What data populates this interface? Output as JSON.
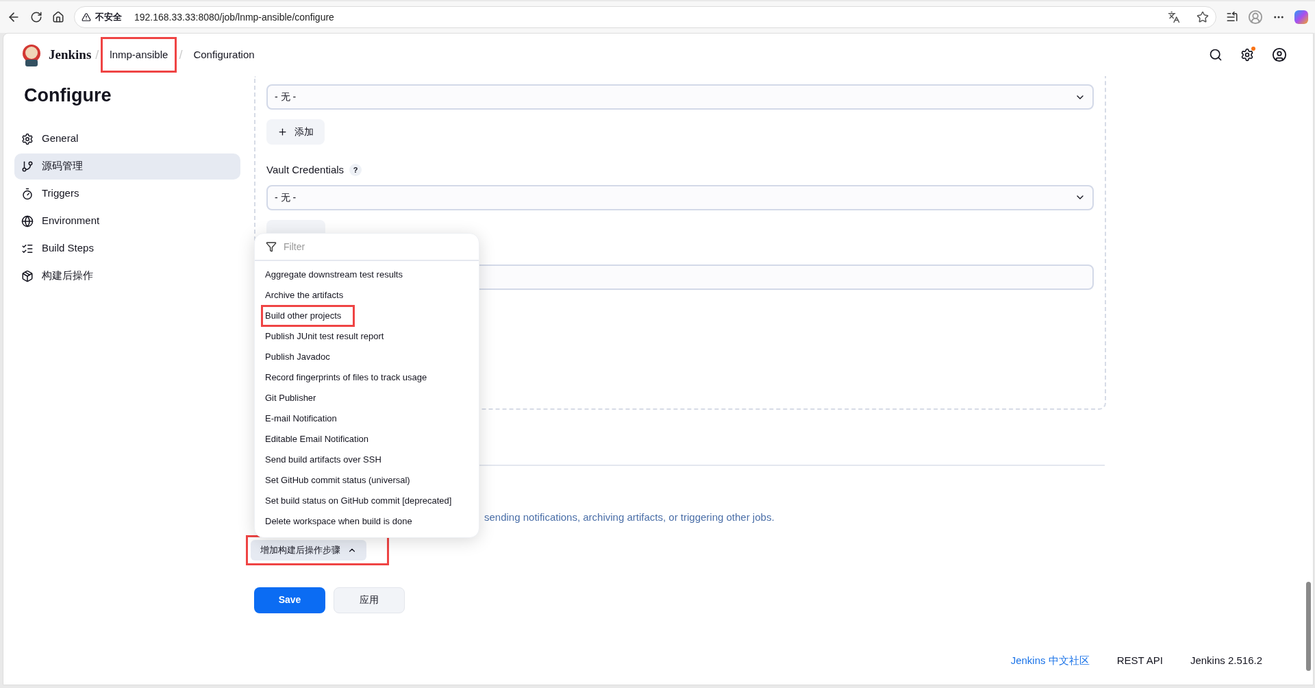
{
  "browser": {
    "security_label": "不安全",
    "url": "192.168.33.33:8080/job/lnmp-ansible/configure"
  },
  "header": {
    "brand": "Jenkins",
    "separator": "/",
    "breadcrumbs": [
      {
        "label": "lnmp-ansible",
        "annotated": true
      },
      {
        "label": "Configuration",
        "annotated": false
      }
    ]
  },
  "sidebar": {
    "title": "Configure",
    "items": [
      {
        "label": "General",
        "selected": false
      },
      {
        "label": "源码管理",
        "selected": true
      },
      {
        "label": "Triggers",
        "selected": false
      },
      {
        "label": "Environment",
        "selected": false
      },
      {
        "label": "Build Steps",
        "selected": false
      },
      {
        "label": "构建后操作",
        "selected": false
      }
    ]
  },
  "form": {
    "fields": [
      {
        "kind": "select",
        "value": "- 无 -"
      },
      {
        "kind": "button",
        "label": "添加"
      },
      {
        "kind": "label",
        "label": "Vault Credentials",
        "help": "?"
      },
      {
        "kind": "select",
        "value": "- 无 -"
      },
      {
        "kind": "covered_button"
      },
      {
        "kind": "input"
      }
    ]
  },
  "post_build": {
    "description": "sending notifications, archiving artifacts, or triggering other jobs.",
    "add_button": {
      "label": "增加构建后操作步骤",
      "expanded": true,
      "annotated": true
    }
  },
  "menu": {
    "filter_placeholder": "Filter",
    "items": [
      {
        "label": "Aggregate downstream test results",
        "annotated": false
      },
      {
        "label": "Archive the artifacts",
        "annotated": false
      },
      {
        "label": "Build other projects",
        "annotated": true
      },
      {
        "label": "Publish JUnit test result report",
        "annotated": false
      },
      {
        "label": "Publish Javadoc",
        "annotated": false
      },
      {
        "label": "Record fingerprints of files to track usage",
        "annotated": false
      },
      {
        "label": "Git Publisher",
        "annotated": false
      },
      {
        "label": "E-mail Notification",
        "annotated": false
      },
      {
        "label": "Editable Email Notification",
        "annotated": false
      },
      {
        "label": "Send build artifacts over SSH",
        "annotated": false
      },
      {
        "label": "Set GitHub commit status (universal)",
        "annotated": false
      },
      {
        "label": "Set build status on GitHub commit [deprecated]",
        "annotated": false
      },
      {
        "label": "Delete workspace when build is done",
        "annotated": false
      }
    ]
  },
  "actions": [
    {
      "label": "Save",
      "kind": "primary"
    },
    {
      "label": "应用",
      "kind": "secondary"
    }
  ],
  "footer": {
    "links": [
      {
        "label": "Jenkins 中文社区",
        "kind": "link"
      },
      {
        "label": "REST API",
        "kind": "plain"
      },
      {
        "label": "Jenkins 2.516.2",
        "kind": "plain"
      }
    ]
  }
}
